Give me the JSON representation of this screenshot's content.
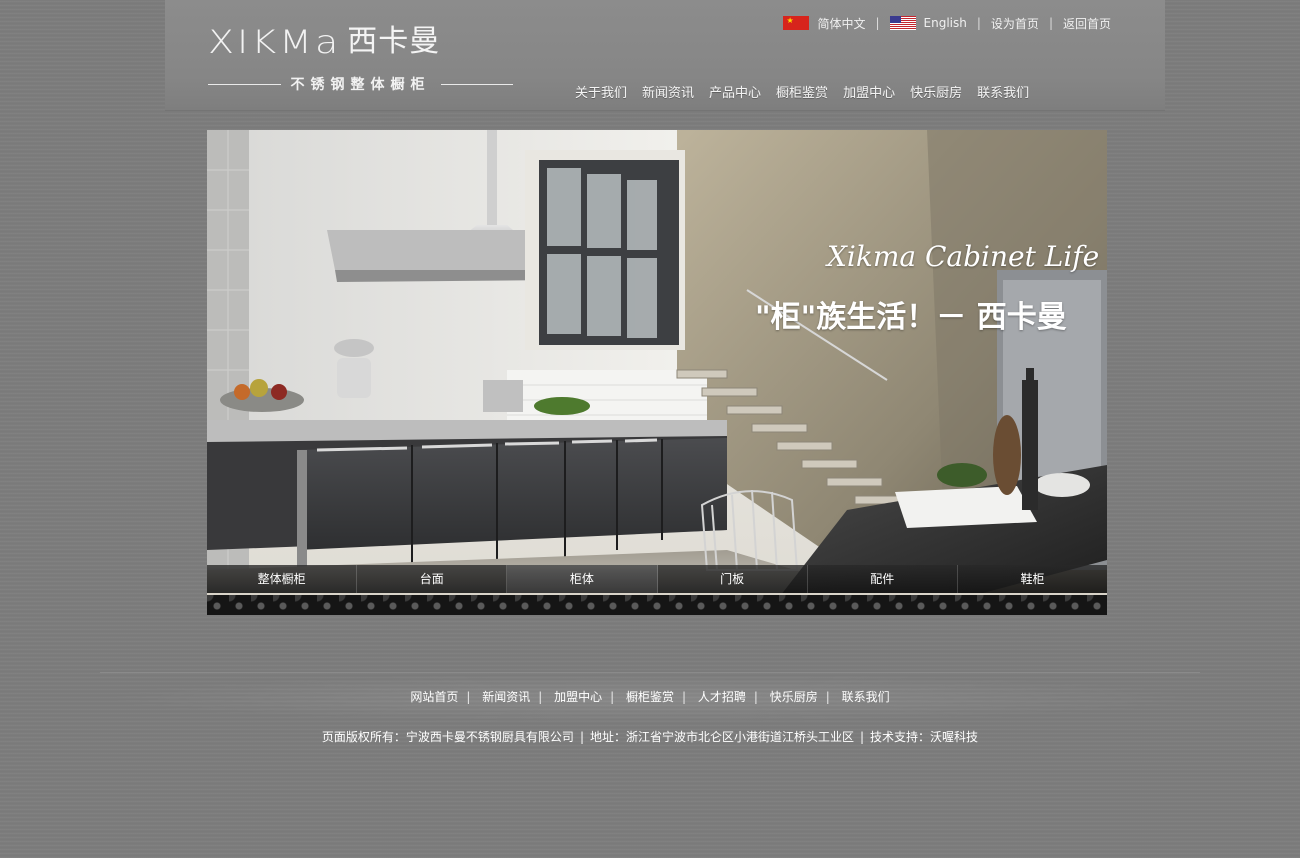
{
  "brand": {
    "logo_latin": "XIKMa",
    "logo_cn": "西卡曼",
    "logo_sub": "不锈钢整体橱柜"
  },
  "top_links": {
    "chinese": "简体中文",
    "english": "English",
    "set_home": "设为首页",
    "back_home": "返回首页"
  },
  "main_nav": [
    "关于我们",
    "新闻资讯",
    "产品中心",
    "橱柜鉴赏",
    "加盟中心",
    "快乐厨房",
    "联系我们"
  ],
  "banner": {
    "title": "Xikma Cabinet Life",
    "slogan": "\"柜\"族生活！－ 西卡曼",
    "categories": [
      "整体橱柜",
      "台面",
      "柜体",
      "门板",
      "配件",
      "鞋柜"
    ],
    "active_category": "柜体"
  },
  "footer": {
    "links": [
      "网站首页",
      "新闻资讯",
      "加盟中心",
      "橱柜鉴赏",
      "人才招聘",
      "快乐厨房",
      "联系我们"
    ],
    "copyright": "页面版权所有：宁波西卡曼不锈钢厨具有限公司",
    "address": "地址：浙江省宁波市北仑区小港街道江桥头工业区",
    "support": "技术支持：沃喔科技"
  }
}
